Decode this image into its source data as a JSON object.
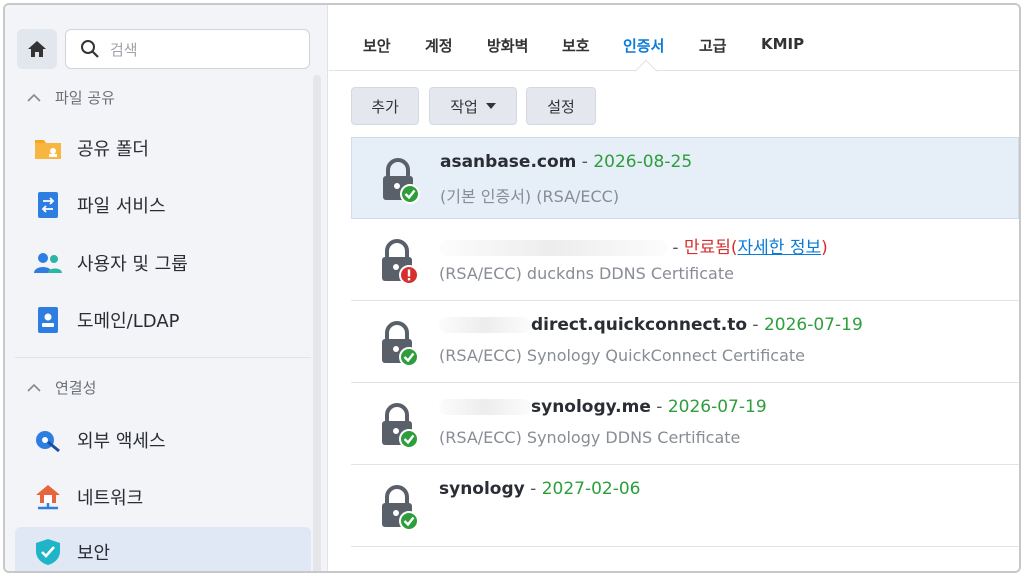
{
  "sidebar": {
    "search_placeholder": "검색",
    "sections": [
      {
        "label": "파일 공유"
      },
      {
        "label": "연결성"
      }
    ],
    "items": [
      {
        "label": "공유 폴더",
        "icon": "shared-folder-icon"
      },
      {
        "label": "파일 서비스",
        "icon": "file-services-icon"
      },
      {
        "label": "사용자 및 그룹",
        "icon": "users-groups-icon"
      },
      {
        "label": "도메인/LDAP",
        "icon": "domain-ldap-icon"
      },
      {
        "label": "외부 액세스",
        "icon": "external-access-icon"
      },
      {
        "label": "네트워크",
        "icon": "network-icon"
      },
      {
        "label": "보안",
        "icon": "security-shield-icon",
        "active": true
      }
    ]
  },
  "tabs": [
    {
      "label": "보안"
    },
    {
      "label": "계정"
    },
    {
      "label": "방화벽"
    },
    {
      "label": "보호"
    },
    {
      "label": "인증서",
      "active": true
    },
    {
      "label": "고급"
    },
    {
      "label": "KMIP"
    }
  ],
  "toolbar": {
    "add": "추가",
    "action": "작업",
    "settings": "설정"
  },
  "certificates": [
    {
      "name": "asanbase.com",
      "sep": " - ",
      "date": "2026-08-25",
      "sub": "(기본 인증서) (RSA/ECC)",
      "status": "valid",
      "selected": true
    },
    {
      "name": "",
      "sep": " - ",
      "expired": "만료됨(",
      "link": "자세한 정보",
      "close": ")",
      "sub": "(RSA/ECC) duckdns DDNS Certificate",
      "status": "expired"
    },
    {
      "name": "direct.quickconnect.to",
      "sep": " - ",
      "date": "2026-07-19",
      "sub": "(RSA/ECC) Synology QuickConnect Certificate",
      "status": "valid"
    },
    {
      "name": "synology.me",
      "sep": " - ",
      "date": "2026-07-19",
      "sub": "(RSA/ECC) Synology DDNS Certificate",
      "status": "valid"
    },
    {
      "name": "synology",
      "sep": " - ",
      "date": "2027-02-06",
      "sub": "",
      "status": "valid"
    }
  ],
  "colors": {
    "accent": "#0a7bd7",
    "valid": "#2e9e3c",
    "expired": "#d62f2f",
    "selected_row": "#e6eef8"
  }
}
